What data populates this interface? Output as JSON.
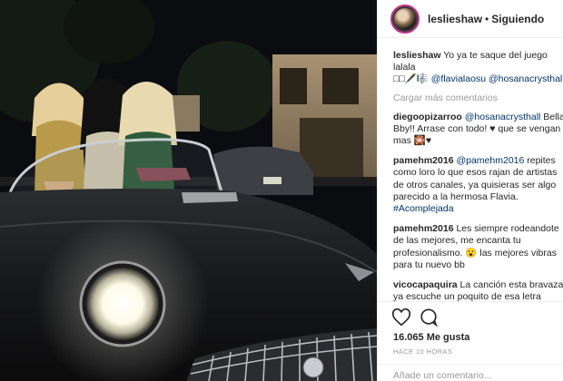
{
  "header": {
    "username": "leslieshaw",
    "separator": "•",
    "follow_label": "Siguiendo",
    "avatar_icon": "profile-avatar"
  },
  "caption": {
    "user": "leslieshaw",
    "text": "Yo ya te saque del juego lalala",
    "emoji_line": "□□🖋️🎼",
    "mention1": "@flavialaosu",
    "mention2": "@hosanacrysthall"
  },
  "load_more": "Cargar más comentarios",
  "comments": [
    {
      "user": "diegoopizarroo",
      "mention": "@hosanacrysthall",
      "text": " Bella Bby!! Arrase con todo! ♥ que se vengan mas 🎇♥"
    },
    {
      "user": "pamehm2016",
      "mention": "@pamehm2016",
      "text": " repites como loro lo que esos rajan de artistas de otros canales, ya quisieras ser algo parecido a la hermosa Flavia. ",
      "tag": "#Acomplejada"
    },
    {
      "user": "pamehm2016",
      "mention": "",
      "text": " Les siempre rodeandote de las mejores, me encanta tu profesionalismo. 😮 las mejores vibras para tu nuevo bb"
    },
    {
      "user": "vicocapaquira",
      "mention": "",
      "text": " La canción esta bravaza ya escuche un poquito de esa letra jajajajajaauque no me gustan tus modelos hosana es la única bueno igual esta año la voy a romper"
    }
  ],
  "actions": {
    "like_icon": "heart-icon",
    "comment_icon": "comment-icon",
    "likes_count": "16.065",
    "likes_label": "Me gusta",
    "time": "HACE 10 HORAS",
    "add_comment_placeholder": "Añade un comentario..."
  },
  "colors": {
    "text": "#262626",
    "link": "#003569",
    "muted": "#999999",
    "border": "#efefef",
    "story_ring": "#c1358c"
  }
}
